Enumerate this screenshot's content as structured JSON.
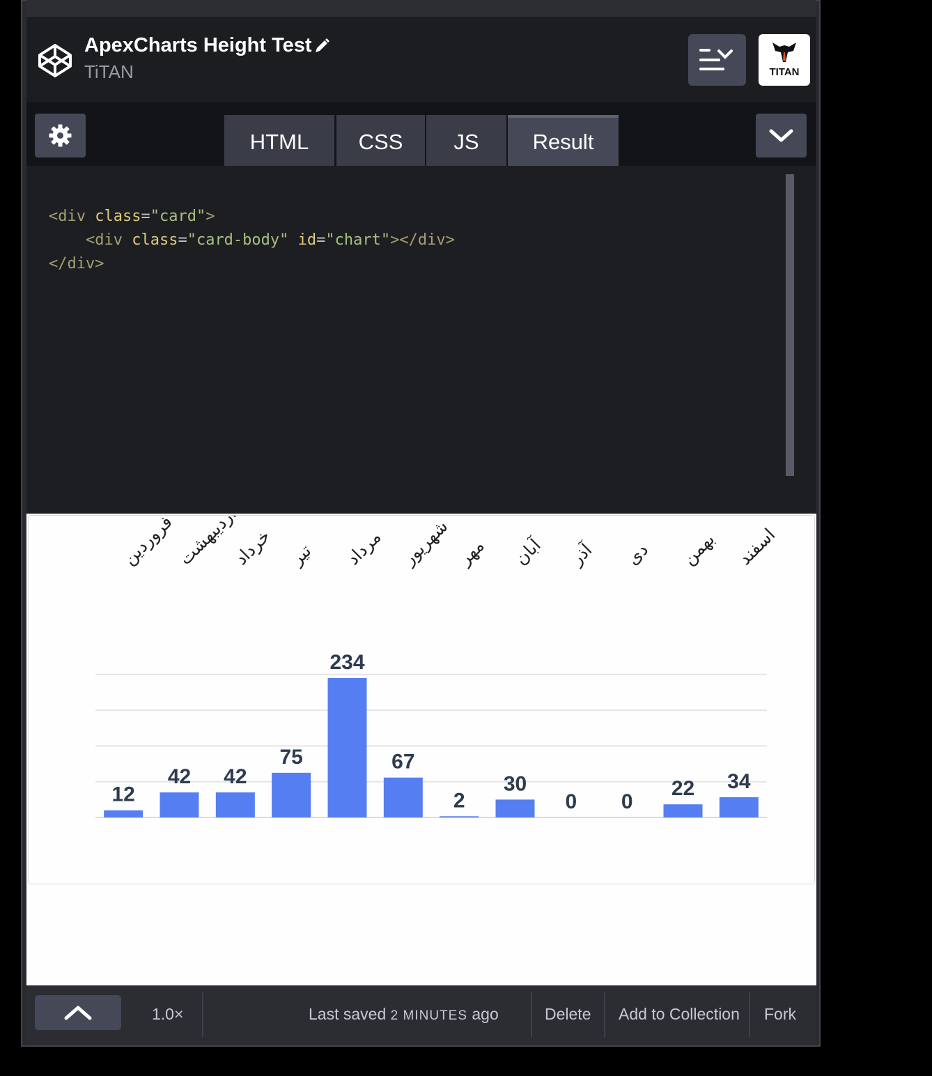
{
  "header": {
    "title": "ApexCharts Height Test",
    "owner": "TiTAN",
    "avatar_text": "TITAN"
  },
  "tabs": [
    "HTML",
    "CSS",
    "JS",
    "Result"
  ],
  "code_lines": [
    "<div class=\"card\">",
    "    <div class=\"card-body\" id=\"chart\"></div>",
    "</div>"
  ],
  "chart_data": {
    "type": "bar",
    "categories": [
      "فروردین",
      "اردیبهشت",
      "خرداد",
      "تیر",
      "مرداد",
      "شهریور",
      "مهر",
      "آبان",
      "آذر",
      "دی",
      "بهمن",
      "اسفند"
    ],
    "values": [
      12,
      42,
      42,
      75,
      234,
      67,
      2,
      30,
      0,
      0,
      22,
      34
    ],
    "data_labels": [
      "12",
      "42",
      "42",
      "75",
      "234",
      "67",
      "2",
      "30",
      "0",
      "0",
      "22",
      "34"
    ],
    "ylim": [
      0,
      240
    ],
    "grid": true,
    "bar_color": "#557ef2",
    "label_color": "#2f3b4e"
  },
  "footer": {
    "zoom": "1.0×",
    "last_saved_prefix": "Last saved",
    "last_saved_time": "2 MINUTES",
    "last_saved_suffix": "ago",
    "delete": "Delete",
    "add_to_collection": "Add to Collection",
    "fork": "Fork"
  }
}
